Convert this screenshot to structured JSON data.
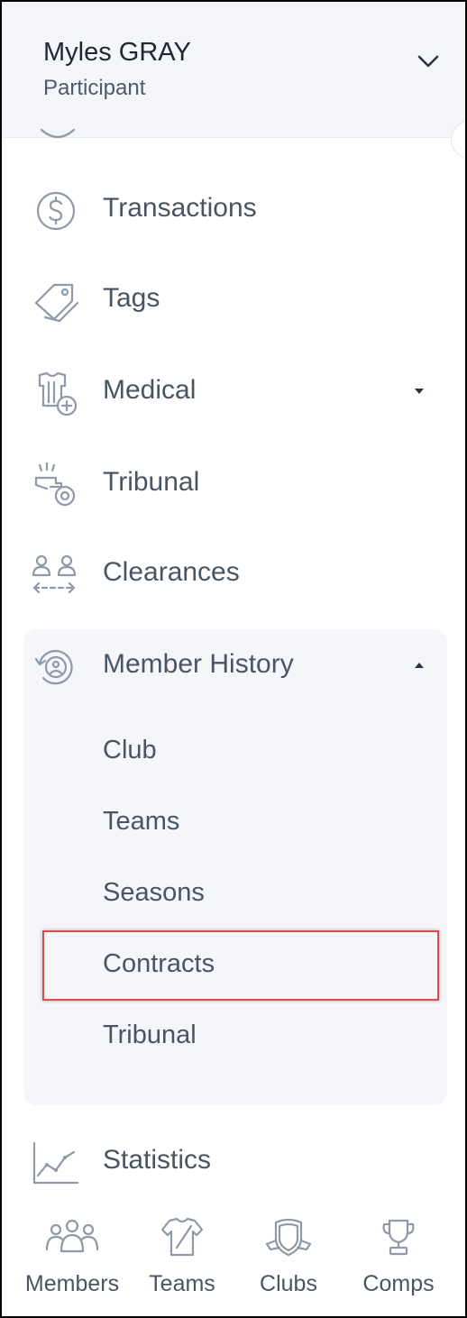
{
  "header": {
    "name": "Myles GRAY",
    "role": "Participant",
    "chevron_icon": "chevron-down-icon"
  },
  "nav": {
    "transactions": {
      "label": "Transactions",
      "icon": "dollar-circle-icon"
    },
    "tags": {
      "label": "Tags",
      "icon": "tag-icon"
    },
    "medical": {
      "label": "Medical",
      "icon": "jersey-medical-icon",
      "caret": "caret-down-icon"
    },
    "tribunal": {
      "label": "Tribunal",
      "icon": "whistle-icon"
    },
    "clearances": {
      "label": "Clearances",
      "icon": "people-transfer-icon"
    },
    "member_history": {
      "label": "Member History",
      "icon": "history-user-icon",
      "caret": "caret-up-icon",
      "expanded": true,
      "children": [
        "Club",
        "Teams",
        "Seasons",
        "Contracts",
        "Tribunal"
      ],
      "selected": "Contracts"
    },
    "statistics": {
      "label": "Statistics",
      "icon": "line-chart-icon"
    }
  },
  "bottom_nav": [
    {
      "label": "Members",
      "icon": "members-icon"
    },
    {
      "label": "Teams",
      "icon": "jersey-icon"
    },
    {
      "label": "Clubs",
      "icon": "shield-icon"
    },
    {
      "label": "Comps",
      "icon": "trophy-icon"
    }
  ],
  "colors": {
    "header_bg": "#f4f6f9",
    "text": "#4a5563",
    "icon": "#8f99a7",
    "highlight_border": "#e0484b"
  }
}
